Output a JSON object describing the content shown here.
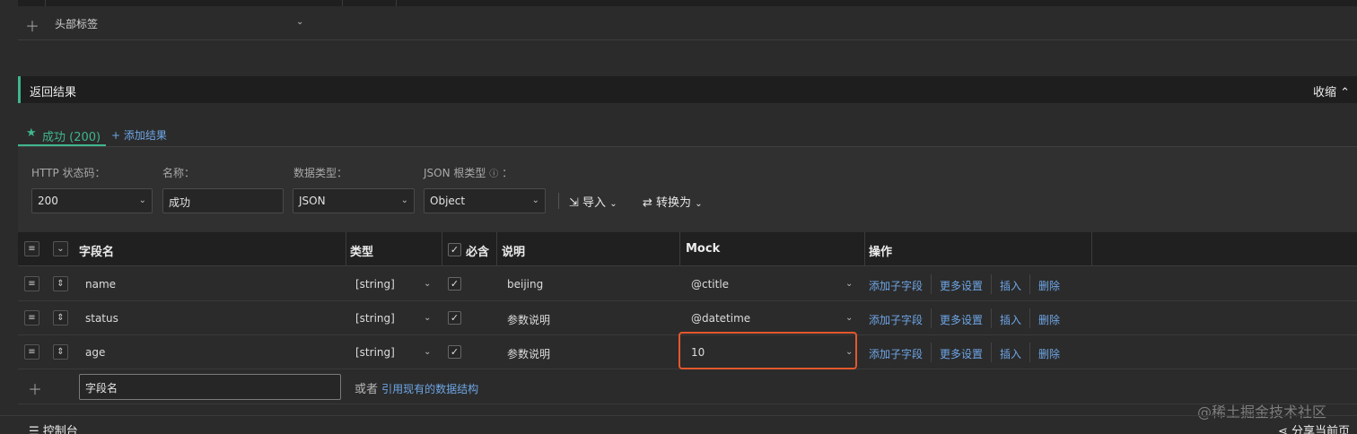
{
  "header_tags": {
    "label": "头部标签"
  },
  "section": {
    "title": "返回结果",
    "collapse_label": "收缩"
  },
  "tabs": {
    "active": "成功 (200)",
    "add": "+ 添加结果"
  },
  "form": {
    "http_status_label": "HTTP 状态码：",
    "http_status_value": "200",
    "name_label": "名称：",
    "name_value": "成功",
    "data_type_label": "数据类型：",
    "data_type_value": "JSON",
    "json_root_label": "JSON 根类型",
    "json_root_colon": "：",
    "json_root_value": "Object",
    "import_label": "导入",
    "convert_label": "转换为"
  },
  "table": {
    "headers": {
      "field": "字段名",
      "type": "类型",
      "required": "必含",
      "desc": "说明",
      "mock": "Mock",
      "actions": "操作"
    },
    "rows": [
      {
        "field": "name",
        "type": "[string]",
        "desc": "beijing",
        "mock": "@ctitle"
      },
      {
        "field": "status",
        "type": "[string]",
        "desc": "参数说明",
        "mock": "@datetime"
      },
      {
        "field": "age",
        "type": "[string]",
        "desc": "参数说明",
        "mock": "10"
      }
    ],
    "actions": {
      "add_child": "添加子字段",
      "more": "更多设置",
      "insert": "插入",
      "delete": "删除"
    },
    "new_row": {
      "placeholder": "字段名",
      "or": "或者",
      "reference": "引用现有的数据结构"
    }
  },
  "bottom": {
    "console": "控制台",
    "share": "分享当前页",
    "watermark": "@稀土掘金技术社区"
  }
}
